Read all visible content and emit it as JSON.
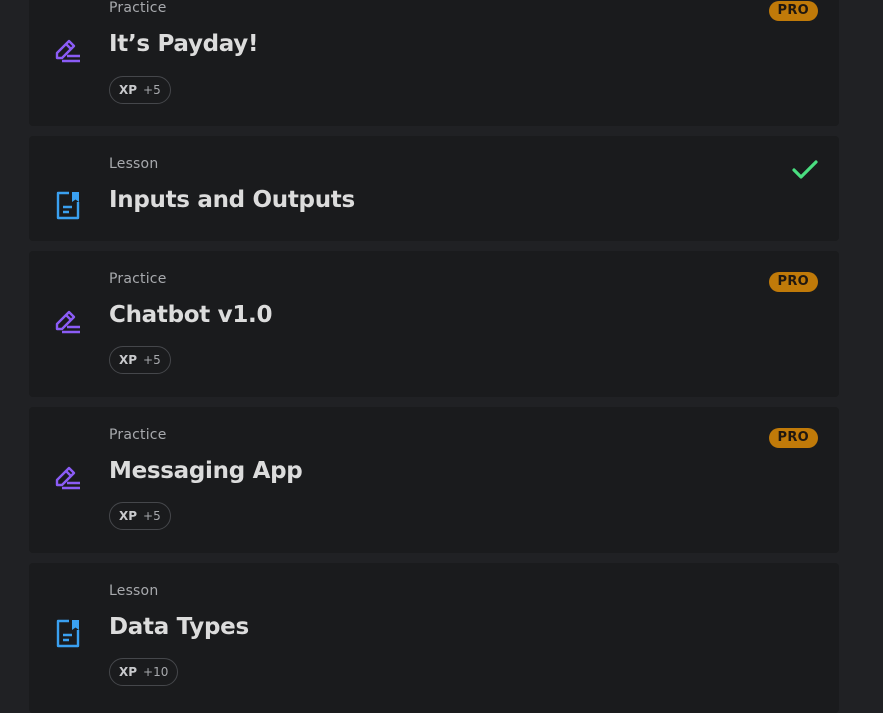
{
  "colors": {
    "background": "#202124",
    "card": "#1a1b1d",
    "practice_icon": "#8b5cf6",
    "lesson_icon": "#3aa0f0",
    "pro_badge": "#c07a09",
    "check": "#4ade80"
  },
  "items": [
    {
      "kind": "Practice",
      "title": "It’s Payday!",
      "xp_label": "XP",
      "xp_value": "+5",
      "badge": "PRO",
      "icon": "pencil-lines-icon"
    },
    {
      "kind": "Lesson",
      "title": "Inputs and Outputs",
      "status": "completed",
      "icon": "document-bookmark-icon"
    },
    {
      "kind": "Practice",
      "title": "Chatbot v1.0",
      "xp_label": "XP",
      "xp_value": "+5",
      "badge": "PRO",
      "icon": "pencil-lines-icon"
    },
    {
      "kind": "Practice",
      "title": "Messaging App",
      "xp_label": "XP",
      "xp_value": "+5",
      "badge": "PRO",
      "icon": "pencil-lines-icon"
    },
    {
      "kind": "Lesson",
      "title": "Data Types",
      "xp_label": "XP",
      "xp_value": "+10",
      "icon": "document-bookmark-icon"
    }
  ]
}
